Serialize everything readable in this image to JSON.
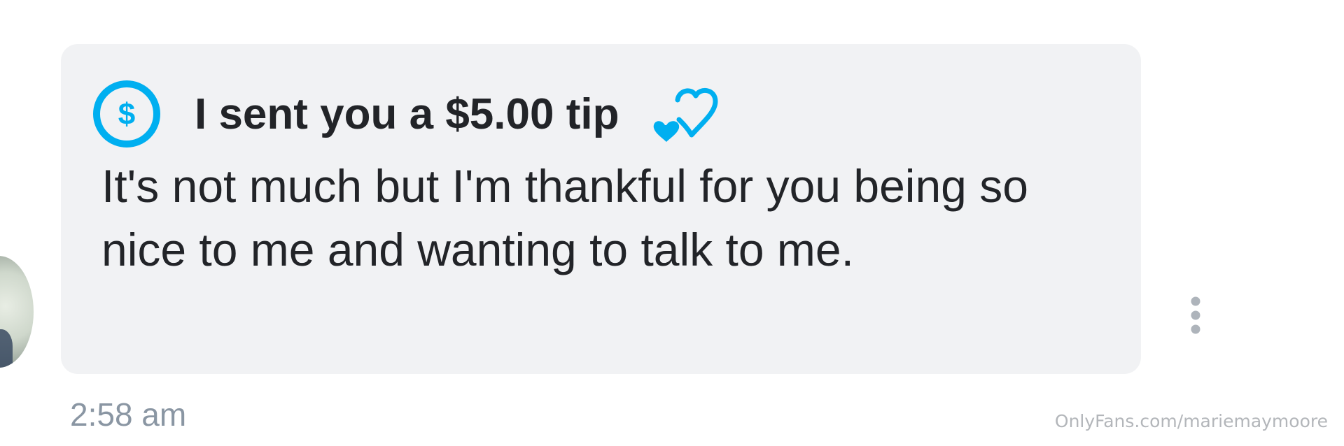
{
  "message": {
    "tip_label": "I sent you a $5.00 tip",
    "text": "It's not much but I'm thankful for you being so nice to me and wanting to talk to me.",
    "timestamp": "2:58 am"
  },
  "icons": {
    "tip": "dollar-circle-icon",
    "reaction": "hearts-icon",
    "menu": "more-vertical-icon"
  },
  "watermark": "OnlyFans.com/mariemaymoore",
  "colors": {
    "accent": "#00aff0",
    "bubble": "#f1f2f4",
    "text": "#222428",
    "timestamp": "#8a96a3",
    "menu_dots": "#aeb4bb"
  }
}
